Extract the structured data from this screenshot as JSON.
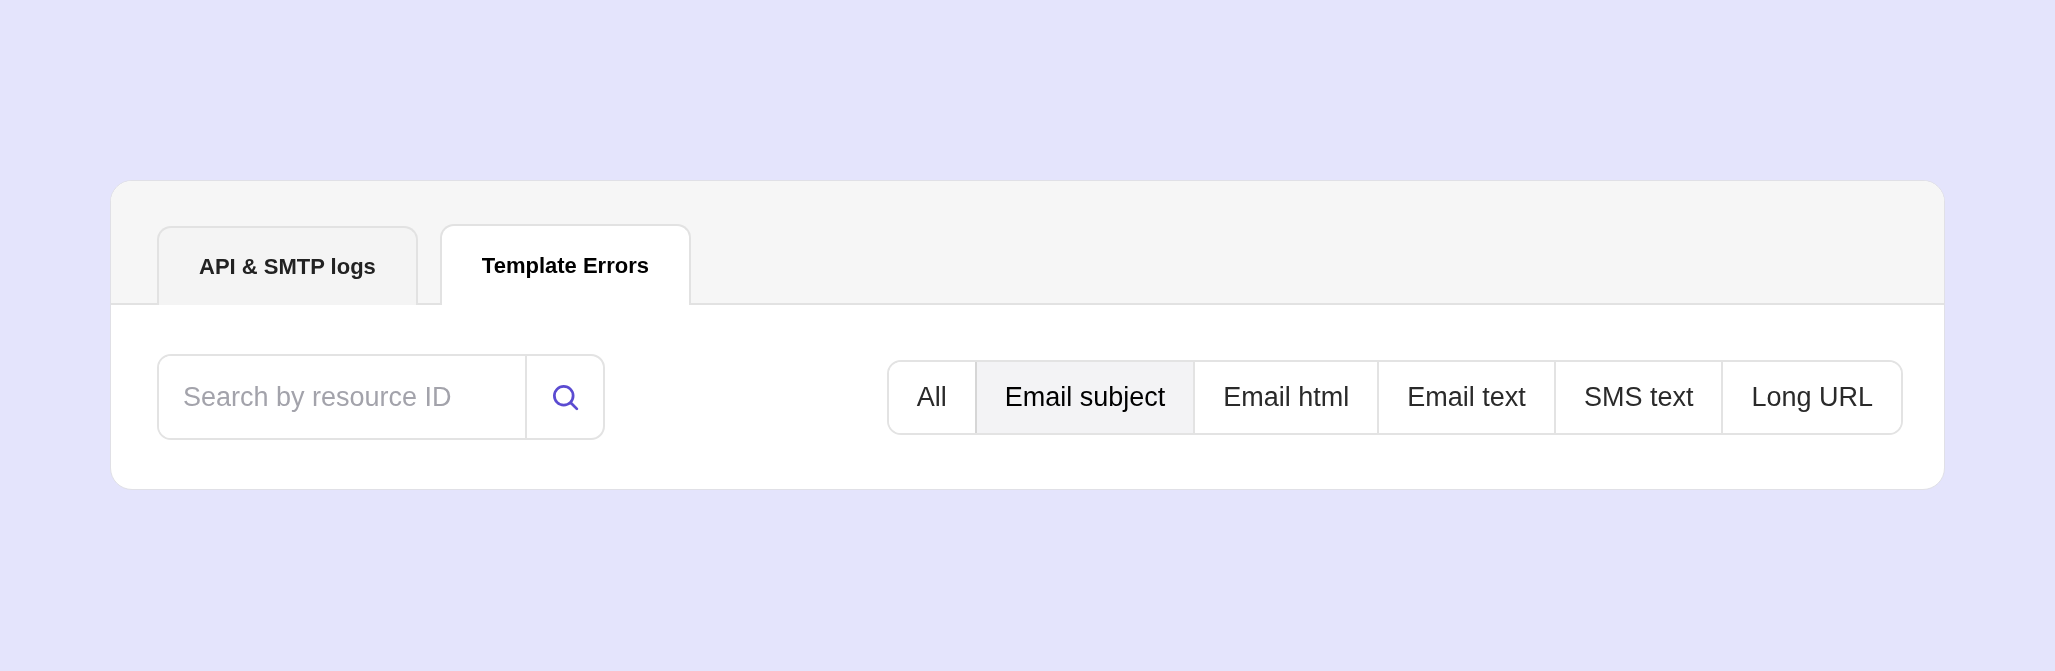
{
  "tabs": [
    {
      "label": "API & SMTP logs",
      "selected": false
    },
    {
      "label": "Template Errors",
      "selected": true
    }
  ],
  "search": {
    "placeholder": "Search by resource ID"
  },
  "filters": [
    {
      "label": "All",
      "selected": false
    },
    {
      "label": "Email subject",
      "selected": true
    },
    {
      "label": "Email html",
      "selected": false
    },
    {
      "label": "Email text",
      "selected": false
    },
    {
      "label": "SMS text",
      "selected": false
    },
    {
      "label": "Long URL",
      "selected": false
    }
  ]
}
